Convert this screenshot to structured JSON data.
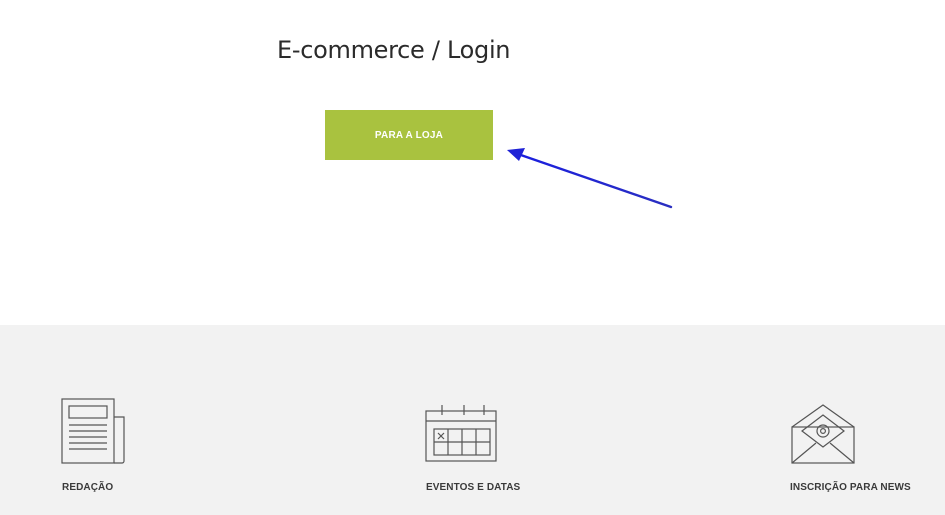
{
  "page": {
    "heading": "E-commerce / Login",
    "shop_button_label": "PARA A LOJA"
  },
  "colors": {
    "button_bg": "#a9c23f",
    "annotation_arrow": "#1f22d6",
    "footer_bg": "#f2f2f2"
  },
  "footer": {
    "items": [
      {
        "label": "REDAÇÃO",
        "icon": "newspaper-icon"
      },
      {
        "label": "EVENTOS E DATAS",
        "icon": "calendar-icon"
      },
      {
        "label": "INSCRIÇÃO PARA NEWS",
        "icon": "envelope-at-icon"
      }
    ]
  }
}
